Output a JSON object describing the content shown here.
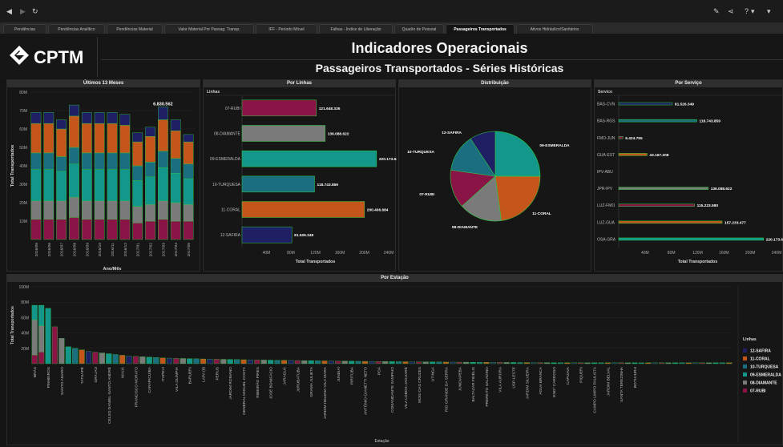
{
  "tabs": [
    {
      "label": "Pendências",
      "active": false
    },
    {
      "label": "Pendências Analítico",
      "active": false
    },
    {
      "label": "Pendências Material",
      "active": false
    },
    {
      "label": "Valor Material Por Passag. Transp.",
      "active": false
    },
    {
      "label": "IFF - Período Móvel",
      "active": false
    },
    {
      "label": "Falhas - Índice de Liberação",
      "active": false
    },
    {
      "label": "Quadro de Pessoal",
      "active": false
    },
    {
      "label": "Passageiros Transportados",
      "active": true
    },
    {
      "label": "Ativos Hidráulico/Sanitários",
      "active": false
    }
  ],
  "toolbar": {
    "back": "◀",
    "forward": "▶",
    "reload": "↻",
    "edit": "✎",
    "share": "⋖",
    "help": "?",
    "help_caret": "▾",
    "menu": "▾"
  },
  "logo_text": "CPTM",
  "title": "Indicadores Operacionais",
  "subtitle": "Passageiros Transportados - Séries Históricas",
  "colors": {
    "12-SAFIRA": "#1f1f66",
    "11-CORAL": "#c4561c",
    "10-TURQUESA": "#1a6e80",
    "09-ESMERALDA": "#12978a",
    "08-DIAMANTE": "#7a7a7a",
    "07-RUBI": "#8a1446",
    "border": "#2ecc40"
  },
  "panels": {
    "ultimos": {
      "title": "Últimos 13 Meses",
      "ylabel": "Total Transportados",
      "xlabel": "Ano/Mês",
      "annotation": "6.830.562"
    },
    "linhas": {
      "title": "Por Linhas",
      "header": "Linhas",
      "xlabel": "Total Transportados"
    },
    "distribuicao": {
      "title": "Distribuição"
    },
    "servico": {
      "title": "Por Serviço",
      "header": "Servico",
      "xlabel": "Total Transportados"
    },
    "estacao": {
      "title": "Por Estação",
      "ylabel": "Total Transportados",
      "xlabel": "Estação",
      "legend_title": "Linhas"
    }
  },
  "chart_data": [
    {
      "type": "bar",
      "title": "Últimos 13 Meses",
      "stacked": true,
      "xlabel": "Ano/Mês",
      "ylabel": "Total Transportados",
      "ylim": [
        0,
        80000000
      ],
      "yticks": [
        "10M",
        "20M",
        "30M",
        "40M",
        "50M",
        "60M",
        "70M",
        "80M"
      ],
      "categories": [
        "2016/05",
        "2016/06",
        "2016/07",
        "2016/08",
        "2016/09",
        "2016/10",
        "2016/11",
        "2016/12",
        "2017/01",
        "2017/02",
        "2017/03",
        "2017/04",
        "2017/05"
      ],
      "series": [
        {
          "name": "07-RUBI",
          "values": [
            11,
            11,
            11,
            12,
            11,
            11,
            11,
            11,
            9,
            10,
            11,
            10,
            10
          ]
        },
        {
          "name": "08-DIAMANTE",
          "values": [
            10,
            10,
            10,
            11,
            10,
            10,
            10,
            10,
            9,
            9,
            10,
            10,
            9
          ]
        },
        {
          "name": "09-ESMERALDA",
          "values": [
            17,
            17,
            16,
            18,
            17,
            17,
            17,
            17,
            14,
            15,
            18,
            16,
            14
          ]
        },
        {
          "name": "10-TURQUESA",
          "values": [
            9,
            9,
            8,
            9,
            9,
            9,
            9,
            9,
            8,
            8,
            9,
            8,
            8
          ]
        },
        {
          "name": "11-CORAL",
          "values": [
            16,
            16,
            15,
            17,
            16,
            16,
            16,
            15,
            13,
            14,
            17,
            15,
            12
          ]
        },
        {
          "name": "12-SAFIRA",
          "values": [
            6,
            6,
            5,
            6,
            6,
            6,
            6,
            6,
            5,
            5,
            7,
            6,
            4
          ]
        }
      ],
      "annotation": "6.830.562"
    },
    {
      "type": "bar",
      "orientation": "horizontal",
      "title": "Por Linhas",
      "xlabel": "Total Transportados",
      "xticks": [
        "40M",
        "80M",
        "120M",
        "160M",
        "200M",
        "240M"
      ],
      "xlim": [
        0,
        240000000
      ],
      "categories": [
        "07-RUBI",
        "08-DIAMANTE",
        "09-ESMERALDA",
        "10-TURQUESA",
        "11-CORAL",
        "12-SAFIRA"
      ],
      "values": [
        121648335,
        136088622,
        220173624,
        118743859,
        200406684,
        81526349
      ],
      "labels": [
        "121.648.335",
        "136.088.622",
        "220.173.624",
        "118.743.859",
        "200.406.684",
        "81.526.349"
      ]
    },
    {
      "type": "pie",
      "title": "Distribuição",
      "categories": [
        "09-ESMERALDA",
        "11-CORAL",
        "08-DIAMANTE",
        "07-RUBI",
        "10-TURQUESA",
        "12-SAFIRA"
      ],
      "values": [
        220173624,
        200406684,
        136088622,
        121648335,
        118743859,
        81526349
      ]
    },
    {
      "type": "bar",
      "orientation": "horizontal",
      "title": "Por Serviço",
      "xlabel": "Total Transportados",
      "xticks": [
        "40M",
        "80M",
        "120M",
        "160M",
        "200M",
        "240M"
      ],
      "xlim": [
        0,
        240000000
      ],
      "categories": [
        "BAS-CVN",
        "BAS-RGS",
        "FMO-JUN",
        "GUA-EST",
        "IPV-ABU",
        "JPR-IPV",
        "LUZ-FMO",
        "LUZ-GUA",
        "OSA-GRA"
      ],
      "values": [
        81526349,
        118743859,
        6424755,
        43167208,
        0,
        136088622,
        115223580,
        157233477,
        220173624
      ],
      "labels": [
        "81.526.349",
        "118.743.859",
        "6.424.755",
        "43.167.208",
        "",
        "136.088.622",
        "115.223.580",
        "157.233.477",
        "220.173.62"
      ],
      "colors": [
        "12-SAFIRA",
        "10-TURQUESA",
        "07-RUBI",
        "11-CORAL",
        "",
        "08-DIAMANTE",
        "07-RUBI",
        "11-CORAL",
        "09-ESMERALDA"
      ]
    },
    {
      "type": "bar",
      "stacked": true,
      "title": "Por Estação",
      "xlabel": "Estação",
      "ylabel": "Total Transportados",
      "ylim": [
        0,
        100000000
      ],
      "yticks": [
        "20M",
        "40M",
        "60M",
        "80M",
        "100M"
      ],
      "categories": [
        "BRÁS",
        "PINHEIROS",
        "SANTO AMARO",
        "TATUAPÉ",
        "GRAJAÚ",
        "CELSO DANIEL-SANTO ANDRÉ",
        "MAUÁ",
        "FRANCISCO MORATO",
        "CARAPICUÍBA",
        "ITAPEVI",
        "VILA OLÍMPIA",
        "BARUERI",
        "LAPA (8)",
        "PERUS",
        "JARDIM ROMANO",
        "GENERAL MIGUEL COSTA",
        "RIBEIRÃO PIRES",
        "JOSÉ BONIFÁCIO",
        "JARAGUÁ",
        "JURUBATUBA",
        "GRAMA JULIETA",
        "JARDIM HELENA-VILA MARA",
        "JUNDIAÍ",
        "PIRITUBA",
        "ANTÔNIO GIANETTI NETO",
        "POÁ",
        "COMANDANTE SAMPAIO",
        "VILA LOBOS-JAGUARÉ",
        "MOGI DAS CRUZES",
        "UTINGA",
        "RIO GRANDE DA SERRA",
        "JUNDIAPEBA",
        "BALTAZAR FIDÉLIS",
        "PREFEITO SALADINO",
        "VILA AURORA",
        "USP-LESTE",
        "JARDIM SILVEIRA",
        "ÁGUA BRANCA",
        "ENGº CARDOSO",
        "CAPUAVA",
        "PIQUERI",
        "CAMPO LIMPO PAULISTA",
        "JARDIM BELVAL",
        "SANTA TEREZINHA",
        "BOTUJURU"
      ],
      "series_legend": [
        "12-SAFIRA",
        "11-CORAL",
        "10-TURQUESA",
        "09-ESMERALDA",
        "08-DIAMANTE",
        "07-RUBI"
      ]
    }
  ]
}
